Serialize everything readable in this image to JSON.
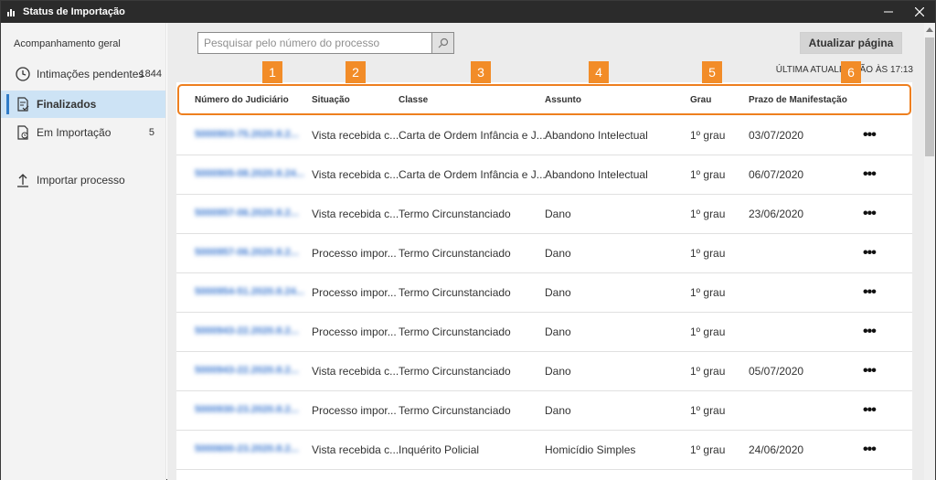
{
  "window": {
    "title": "Status de Importação"
  },
  "sidebar": {
    "heading": "Acompanhamento geral",
    "items": [
      {
        "label": "Intimações pendentes",
        "count": "1844",
        "icon": "clock-icon"
      },
      {
        "label": "Finalizados",
        "count": "",
        "icon": "document-check-icon",
        "active": true
      },
      {
        "label": "Em Importação",
        "count": "5",
        "icon": "document-sync-icon"
      },
      {
        "label": "Importar processo",
        "count": "",
        "icon": "upload-arrow-icon"
      }
    ]
  },
  "toolbar": {
    "search_placeholder": "Pesquisar pelo número do processo",
    "refresh_label": "Atualizar página",
    "last_update": "ÚLTIMA ATUALIZAÇÃO ÀS 17:13"
  },
  "table": {
    "columns": [
      "Número do Judiciário",
      "Situação",
      "Classe",
      "Assunto",
      "Grau",
      "Prazo de Manifestação"
    ],
    "badges": [
      "1",
      "2",
      "3",
      "4",
      "5",
      "6"
    ],
    "rows": [
      {
        "numero": "5000903-75.2020.8.2...",
        "situacao": "Vista recebida c...",
        "classe": "Carta de Ordem Infância e J...",
        "assunto": "Abandono Intelectual",
        "grau": "1º grau",
        "prazo": "03/07/2020"
      },
      {
        "numero": "5000905-08.2020.8.24...",
        "situacao": "Vista recebida c...",
        "classe": "Carta de Ordem Infância e J...",
        "assunto": "Abandono Intelectual",
        "grau": "1º grau",
        "prazo": "06/07/2020"
      },
      {
        "numero": "5000957-06.2020.8.2...",
        "situacao": "Vista recebida c...",
        "classe": "Termo Circunstanciado",
        "assunto": "Dano",
        "grau": "1º grau",
        "prazo": "23/06/2020"
      },
      {
        "numero": "5000957-06.2020.8.2...",
        "situacao": "Processo impor...",
        "classe": "Termo Circunstanciado",
        "assunto": "Dano",
        "grau": "1º grau",
        "prazo": ""
      },
      {
        "numero": "5000954-51.2020.8.24...",
        "situacao": "Processo impor...",
        "classe": "Termo Circunstanciado",
        "assunto": "Dano",
        "grau": "1º grau",
        "prazo": ""
      },
      {
        "numero": "5000943-22.2020.8.2...",
        "situacao": "Processo impor...",
        "classe": "Termo Circunstanciado",
        "assunto": "Dano",
        "grau": "1º grau",
        "prazo": ""
      },
      {
        "numero": "5000943-22.2020.8.2...",
        "situacao": "Vista recebida c...",
        "classe": "Termo Circunstanciado",
        "assunto": "Dano",
        "grau": "1º grau",
        "prazo": "05/07/2020"
      },
      {
        "numero": "5000930-23.2020.8.2...",
        "situacao": "Processo impor...",
        "classe": "Termo Circunstanciado",
        "assunto": "Dano",
        "grau": "1º grau",
        "prazo": ""
      },
      {
        "numero": "5000600-23.2020.8.2...",
        "situacao": "Vista recebida c...",
        "classe": "Inquérito Policial",
        "assunto": "Homicídio Simples",
        "grau": "1º grau",
        "prazo": "24/06/2020"
      }
    ],
    "more_label": "•••"
  },
  "colors": {
    "accent": "#2f7bc7",
    "highlight": "#ee7f1f",
    "badge": "#f28c28",
    "link": "#3b78d0"
  }
}
